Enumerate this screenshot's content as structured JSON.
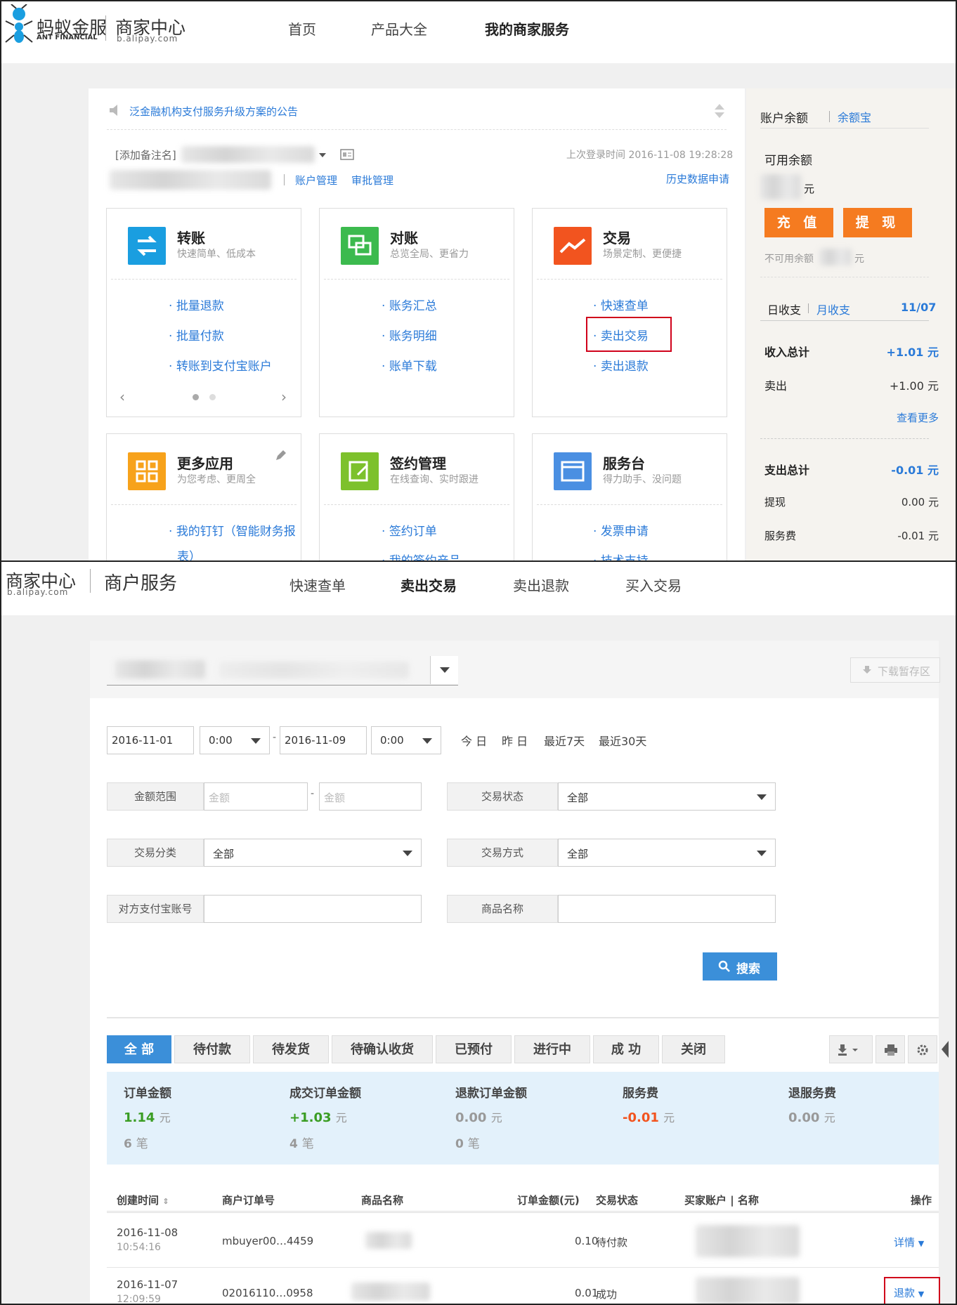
{
  "colors": {
    "accent": "#2a7ad8",
    "orange": "#f57b20",
    "tab_active": "#3b8fd9",
    "highlight": "#d0021b",
    "green": "#3a9d23",
    "red": "#f2541f"
  },
  "panel1": {
    "brand": {
      "cn": "蚂蚁金服",
      "en": "ANT FINANCIAL"
    },
    "merchant": {
      "title": "商家中心",
      "sub": "b.alipay.com"
    },
    "nav": [
      "首页",
      "产品大全",
      "我的商家服务"
    ],
    "notice": "泛金融机构支付服务升级方案的公告",
    "remark_placeholder": "[添加备注名]",
    "last_login": "上次登录时间 2016-11-08 19:28:28",
    "links": {
      "account": "账户管理",
      "approval": "审批管理",
      "history": "历史数据申请"
    },
    "tiles": [
      {
        "title": "转账",
        "sub": "快速简单、低成本",
        "links": [
          "批量退款",
          "批量付款",
          "转账到支付宝账户"
        ]
      },
      {
        "title": "对账",
        "sub": "总览全局、更省力",
        "links": [
          "账务汇总",
          "账务明细",
          "账单下载"
        ]
      },
      {
        "title": "交易",
        "sub": "场景定制、更便捷",
        "links": [
          "快速查单",
          "卖出交易",
          "卖出退款"
        ]
      },
      {
        "title": "更多应用",
        "sub": "为您考虑、更周全",
        "links": [
          "我的钉钉（智能财务报",
          "表）"
        ]
      },
      {
        "title": "签约管理",
        "sub": "在线查询、实时跟进",
        "links": [
          "签约订单",
          "我的签约产品"
        ]
      },
      {
        "title": "服务台",
        "sub": "得力助手、没问题",
        "links": [
          "发票申请",
          "技术支持"
        ]
      }
    ],
    "side": {
      "tab_balance": "账户余额",
      "tab_yuebao": "余额宝",
      "available": "可用余额",
      "yuan": "元",
      "recharge": "充 值",
      "withdraw": "提 现",
      "unavailable": "不可用余额",
      "day": "日收支",
      "month": "月收支",
      "date": "11/07",
      "income_total": "收入总计",
      "income_total_v": "+1.01 元",
      "sell": "卖出",
      "sell_v": "+1.00 元",
      "more": "查看更多",
      "expense_total": "支出总计",
      "expense_total_v": "-0.01 元",
      "withdraw_l": "提现",
      "withdraw_v": "0.00 元",
      "fee": "服务费",
      "fee_v": "-0.01 元"
    }
  },
  "panel2": {
    "merchant": {
      "title": "商家中心",
      "sub": "b.alipay.com",
      "section": "商户服务"
    },
    "nav": [
      "快速查单",
      "卖出交易",
      "卖出退款",
      "买入交易"
    ],
    "download": "下载暂存区",
    "date_from": "2016-11-01",
    "time_from": "0:00",
    "date_to": "2016-11-09",
    "time_to": "0:00",
    "quick": [
      "今 日",
      "昨 日",
      "最近7天",
      "最近30天"
    ],
    "filters": {
      "amount_range": "金额范围",
      "amount_ph": "金额",
      "trade_status": "交易状态",
      "trade_class": "交易分类",
      "trade_method": "交易方式",
      "all": "全部",
      "counterpart": "对方支付宝账号",
      "product": "商品名称"
    },
    "search": "搜索",
    "tabs": [
      "全 部",
      "待付款",
      "待发货",
      "待确认收货",
      "已预付",
      "进行中",
      "成 功",
      "关闭"
    ],
    "summary": [
      {
        "label": "订单金额",
        "value": "1.14",
        "unit": "元",
        "count": "6",
        "count_unit": "笔"
      },
      {
        "label": "成交订单金额",
        "value": "+1.03",
        "unit": "元",
        "count": "4",
        "count_unit": "笔"
      },
      {
        "label": "退款订单金额",
        "value": "0.00",
        "unit": "元",
        "count": "0",
        "count_unit": "笔"
      },
      {
        "label": "服务费",
        "value": "-0.01",
        "unit": "元"
      },
      {
        "label": "退服务费",
        "value": "0.00",
        "unit": "元"
      }
    ],
    "columns": [
      "创建时间",
      "商户订单号",
      "商品名称",
      "订单金额(元)",
      "交易状态",
      "买家账户 | 名称",
      "操作"
    ],
    "rows": [
      {
        "date": "2016-11-08",
        "time": "10:54:16",
        "order": "mbuyer00…4459",
        "amount": "0.10",
        "status": "待付款",
        "action": "详情"
      },
      {
        "date": "2016-11-07",
        "time": "12:09:59",
        "order": "02016110…0958",
        "amount": "0.01",
        "status": "成功",
        "action": "退款"
      }
    ]
  }
}
